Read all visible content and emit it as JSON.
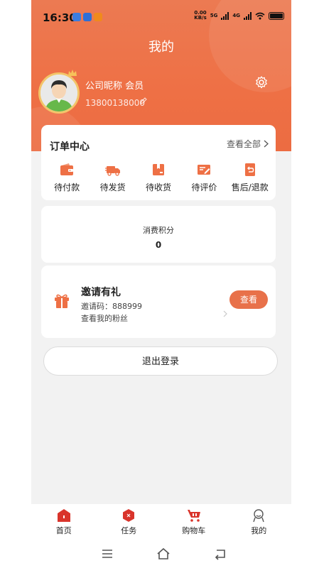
{
  "status_bar": {
    "time": "16:30",
    "speed_value": "0.00",
    "speed_unit": "KB/s",
    "net_5g": "5G",
    "net_4g": "4G"
  },
  "header": {
    "title": "我的"
  },
  "profile": {
    "nickname": "公司昵称 会员",
    "phone": "13800138000"
  },
  "orders": {
    "title": "订单中心",
    "view_all": "查看全部",
    "items": [
      {
        "label": "待付款",
        "icon": "wallet-icon"
      },
      {
        "label": "待发货",
        "icon": "truck-icon"
      },
      {
        "label": "待收货",
        "icon": "box-icon"
      },
      {
        "label": "待评价",
        "icon": "review-icon"
      },
      {
        "label": "售后/退款",
        "icon": "refund-icon"
      }
    ]
  },
  "points": {
    "label": "消费积分",
    "value": "0"
  },
  "invite": {
    "title": "邀请有礼",
    "code": "邀请码：888999",
    "fans": "查看我的粉丝",
    "button": "查看"
  },
  "logout": {
    "label": "退出登录"
  },
  "tabbar": {
    "items": [
      {
        "label": "首页",
        "icon": "home-icon"
      },
      {
        "label": "任务",
        "icon": "task-icon"
      },
      {
        "label": "购物车",
        "icon": "cart-icon"
      },
      {
        "label": "我的",
        "icon": "profile-icon"
      }
    ]
  },
  "colors": {
    "accent": "#ee7045",
    "button": "#e8714a",
    "tab_icon": "#d9342b"
  }
}
